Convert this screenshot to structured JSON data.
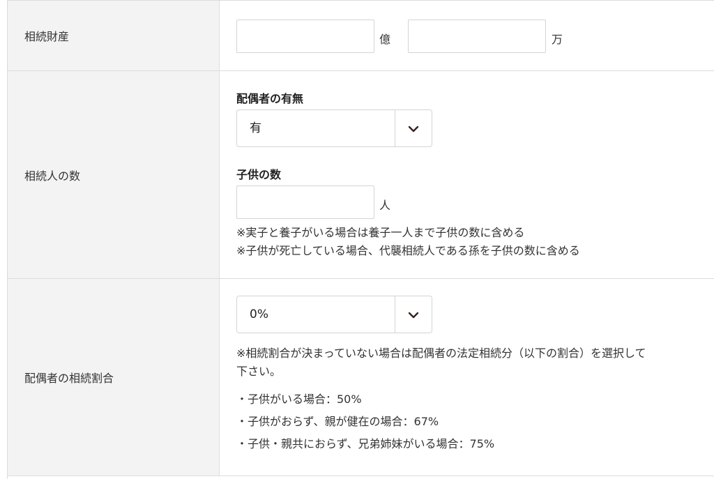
{
  "rows": {
    "estate": {
      "label": "相続財産",
      "unit_oku": "億",
      "unit_man": "万",
      "oku_value": "",
      "man_value": ""
    },
    "heirs": {
      "label": "相続人の数",
      "spouse_label": "配偶者の有無",
      "spouse_value": "有",
      "children_label": "子供の数",
      "children_value": "",
      "children_unit": "人",
      "note_1": "※実子と養子がいる場合は養子一人まで子供の数に含める",
      "note_2": "※子供が死亡している場合、代襲相続人である孫を子供の数に含める"
    },
    "spouse_share": {
      "label": "配偶者の相続割合",
      "share_value": "0%",
      "note_line_1": "※相続割合が決まっていない場合は配偶者の法定相続分（以下の割合）を選択して",
      "note_line_2": "下さい。",
      "case_1": "・子供がいる場合：50%",
      "case_2": "・子供がおらず、親が健在の場合：67%",
      "case_3": "・子供・親共におらず、兄弟姉妹がいる場合：75%"
    }
  },
  "icons": {
    "select_arrow": "chevron-down-icon"
  },
  "colors": {
    "label_bg": "#f3f3f3",
    "border": "#dcdcdc",
    "chevron": "#3a1f1f"
  }
}
